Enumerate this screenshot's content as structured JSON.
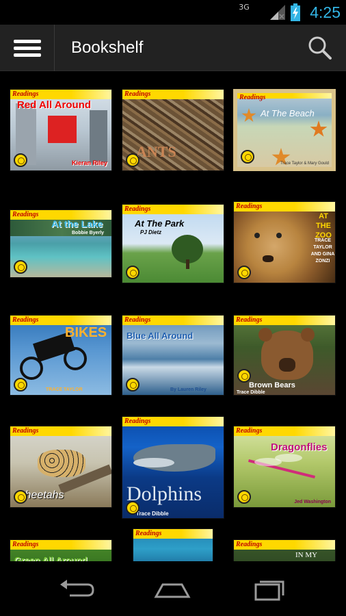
{
  "status_bar": {
    "network": "3G",
    "time": "4:25",
    "icons": [
      "signal-icon",
      "battery-charging-icon"
    ],
    "accent_color": "#33b5e5"
  },
  "action_bar": {
    "title": "Bookshelf",
    "icons": [
      "menu-icon",
      "search-icon"
    ]
  },
  "series_label": "Readings",
  "books": [
    {
      "title": "Red All Around",
      "author": "Kieran Riley"
    },
    {
      "title": "ANTS",
      "author": ""
    },
    {
      "title": "At The Beach",
      "author": "Trace Taylor & Mary Gould"
    },
    {
      "title": "At the Lake",
      "author": "Bobbie Byerly"
    },
    {
      "title": "At The Park",
      "author": "PJ Dietz"
    },
    {
      "title": "AT THE ZOO",
      "author": "TRACE TAYLOR AND GINA ZONZI"
    },
    {
      "title": "BIKES",
      "author": "TRACE TAYLOR"
    },
    {
      "title": "Blue All Around",
      "author": "By Lauren Riley"
    },
    {
      "title": "Brown Bears",
      "author": "Trace Dibble"
    },
    {
      "title": "Cheetahs",
      "author": ""
    },
    {
      "title": "Dolphins",
      "author": "Trace Dibble"
    },
    {
      "title": "Dragonflies",
      "author": "Jed Washington"
    },
    {
      "title": "Green All Around",
      "author": ""
    },
    {
      "title": "",
      "author": ""
    },
    {
      "title": "IN MY",
      "author": ""
    }
  ],
  "nav_bar": {
    "icons": [
      "back-icon",
      "home-icon",
      "recent-apps-icon"
    ]
  }
}
